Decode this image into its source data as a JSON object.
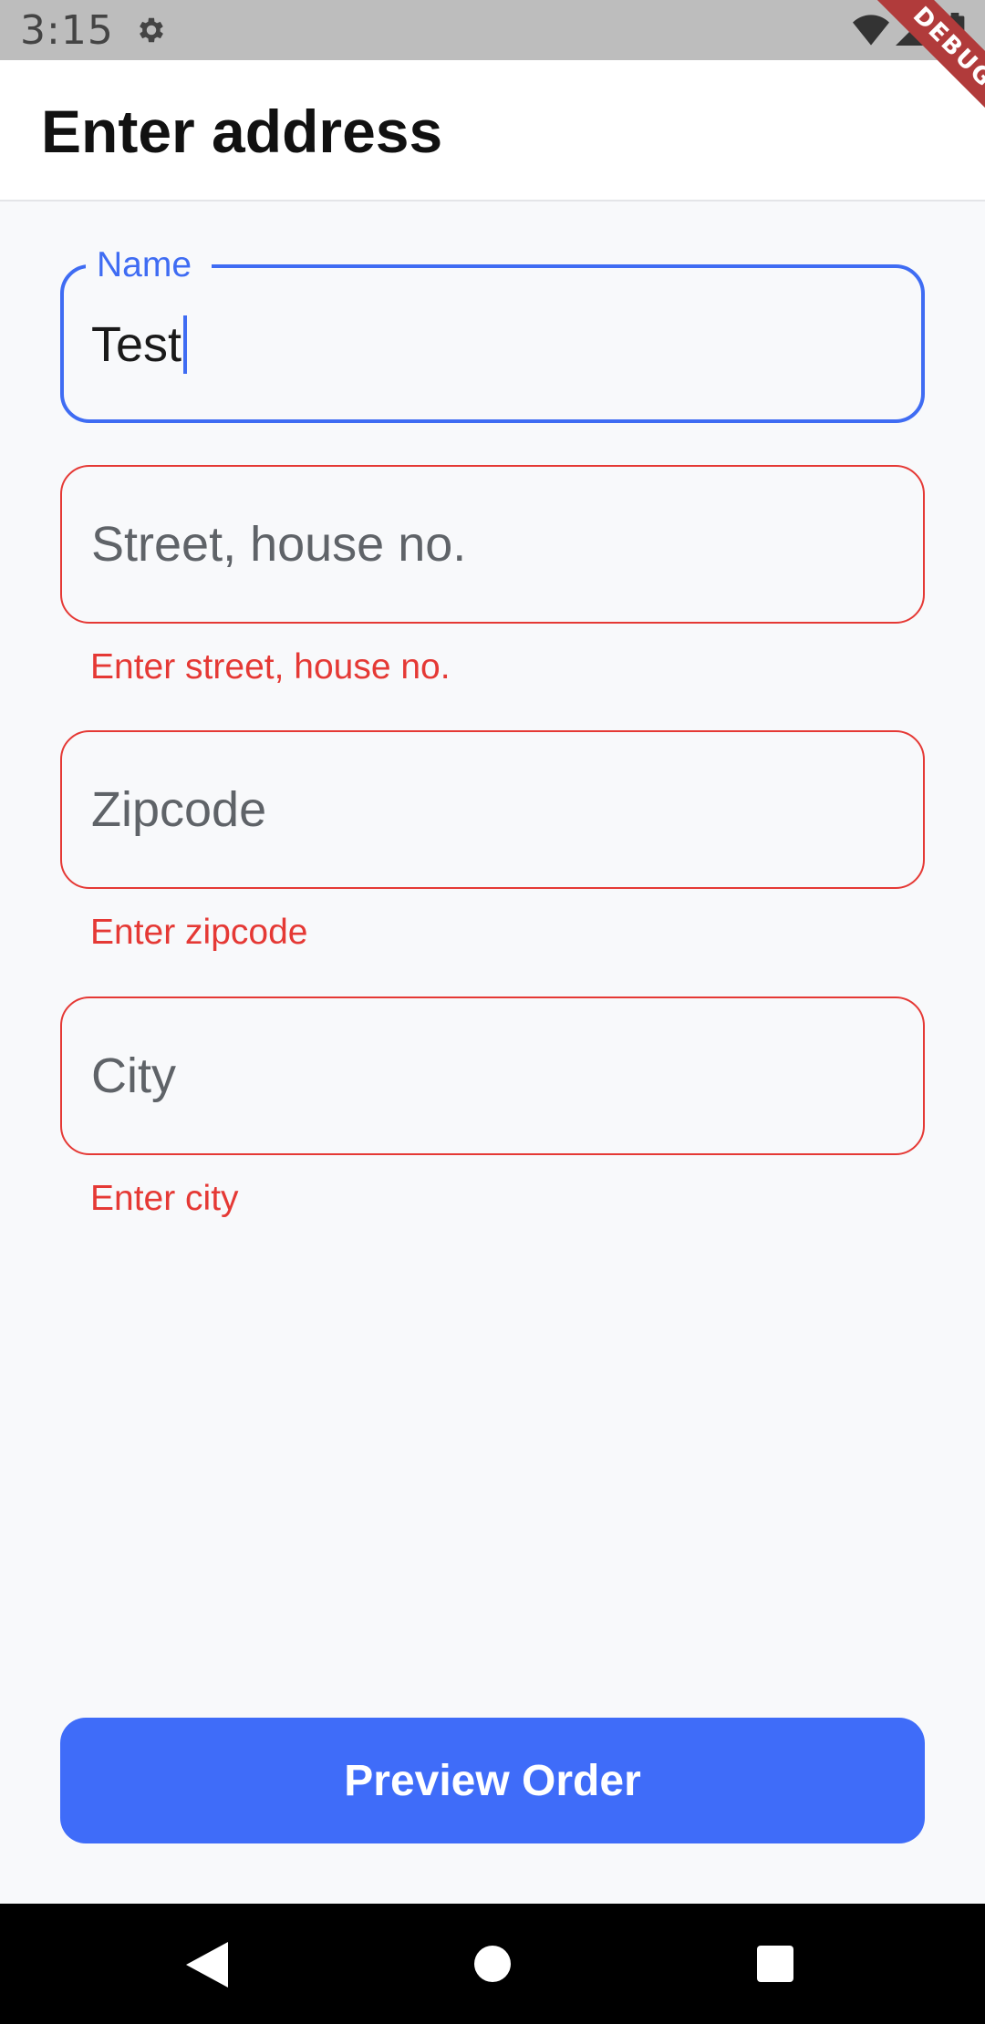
{
  "status_bar": {
    "time": "3:15",
    "icons": [
      "gear-icon",
      "wifi-icon",
      "cell-signal-icon",
      "battery-icon"
    ]
  },
  "debug_banner": "DEBUG",
  "app_bar": {
    "title": "Enter address"
  },
  "form": {
    "name": {
      "label": "Name",
      "value": "Test"
    },
    "street": {
      "placeholder": "Street, house no.",
      "error": "Enter street, house no."
    },
    "zipcode": {
      "placeholder": "Zipcode",
      "error": "Enter zipcode"
    },
    "city": {
      "placeholder": "City",
      "error": "Enter city"
    }
  },
  "actions": {
    "preview_label": "Preview Order"
  },
  "nav_bar": {
    "icons": [
      "back-icon",
      "home-icon",
      "recents-icon"
    ]
  },
  "colors": {
    "accent": "#3f6cf9",
    "error": "#e53935",
    "background": "#f8f9fb"
  }
}
